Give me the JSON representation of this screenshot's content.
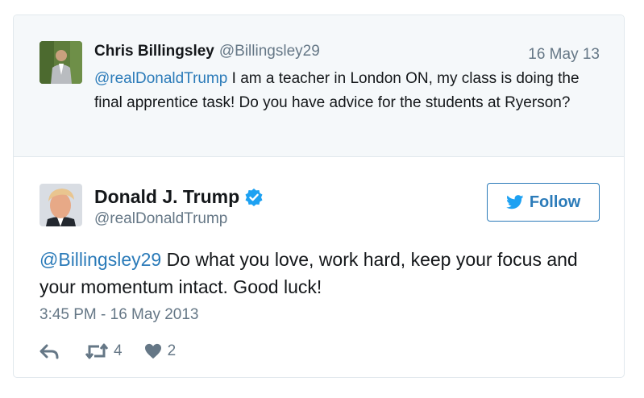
{
  "parent_tweet": {
    "author_name": "Chris Billingsley",
    "author_handle": "@Billingsley29",
    "date": "16 May 13",
    "mention": "@realDonaldTrump",
    "text": " I am a teacher in London ON, my class is doing the final apprentice task! Do you have advice for the students at Ryerson?"
  },
  "main_tweet": {
    "author_name": "Donald J. Trump",
    "author_handle": "@realDonaldTrump",
    "verified_icon": "verified-badge-icon",
    "mention": "@Billingsley29",
    "text": " Do what you love, work hard, keep your focus and your momentum intact. Good luck!",
    "timestamp": "3:45 PM - 16 May 2013",
    "retweet_count": "4",
    "like_count": "2"
  },
  "follow_button": {
    "label": "Follow",
    "icon": "twitter-bird-icon"
  },
  "colors": {
    "accent": "#2b7bb9",
    "muted": "#657786",
    "verified": "#1da1f2",
    "parent_bg": "#f5f8fa",
    "border": "#e1e8ed"
  }
}
